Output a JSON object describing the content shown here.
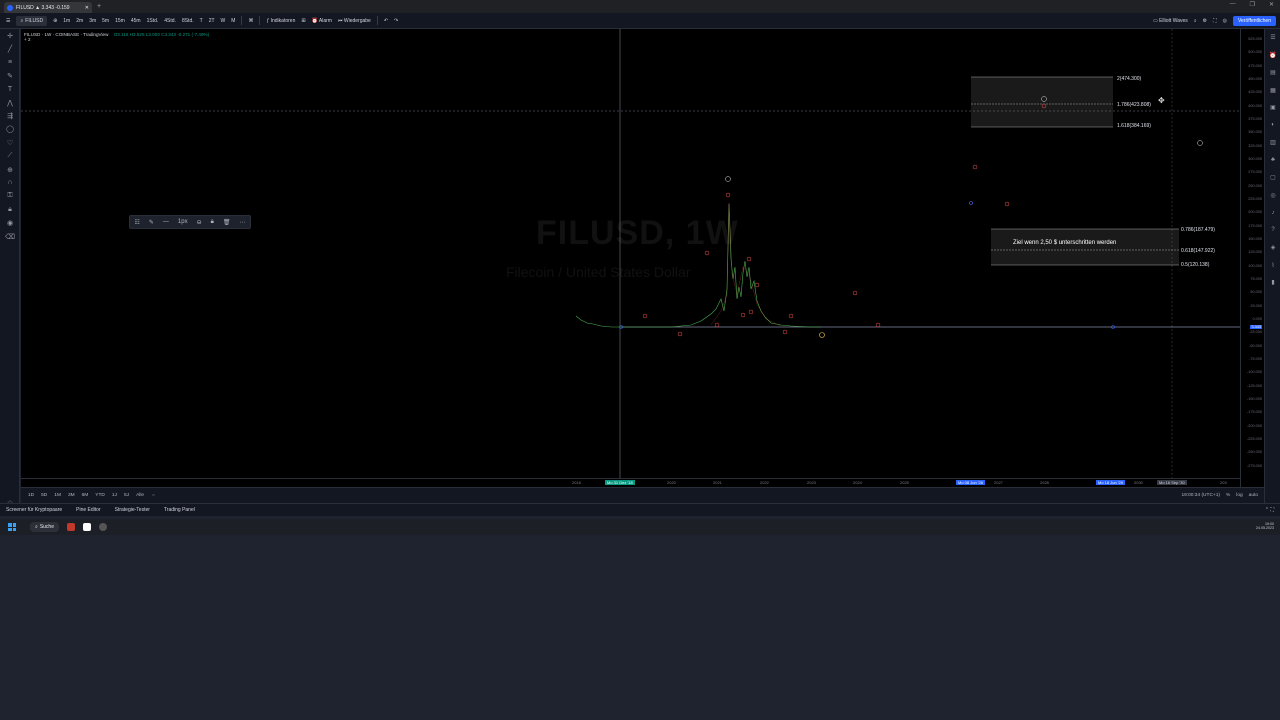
{
  "browser": {
    "tab_title": "FILUSD ▲ 3.343 -0.159",
    "new_tab": "+",
    "win_controls": [
      "—",
      "❐",
      "✕"
    ]
  },
  "toolbar": {
    "symbol": "FILUSD",
    "intervals": [
      "1m",
      "2m",
      "3m",
      "5m",
      "15m",
      "45m",
      "1Std.",
      "4Std.",
      "8Std.",
      "T",
      "2T",
      "W",
      "M"
    ],
    "indicators_label": "Indikatoren",
    "alert_label": "Alarm",
    "replay_label": "Wiedergabe",
    "layout_label": "Elliott Waves",
    "publish_label": "Veröffentlichen"
  },
  "chart": {
    "title": "FILUSD · 1W · COINBASE · TradingView",
    "ohlc": "O3.116 H3.525 L3.003 C3.343 -0.271 (-7.49%)",
    "sub": "+ 2",
    "watermark_symbol": "FILUSD, 1W",
    "watermark_desc": "Filecoin / United States Dollar",
    "target_text": "Ziel wenn 2,50 $ unterschritten werden",
    "fib_levels": [
      {
        "label": "2(474.300)"
      },
      {
        "label": "1.786(423.808)"
      },
      {
        "label": "1.618(384.169)"
      },
      {
        "label": "0.786(187.479)"
      },
      {
        "label": "0.618(147.922)"
      },
      {
        "label": "0.5(120.138)"
      }
    ],
    "wave_labels_white": [
      "⑤",
      "⑤",
      "②",
      "⑧"
    ],
    "wave_labels_red": [
      "①",
      "②",
      "③",
      "④",
      "⑤",
      "⓪",
      "①",
      "②",
      "③",
      "④",
      "⑤",
      "①",
      "②",
      "③"
    ],
    "price_axis": [
      "525.000",
      "500.000",
      "475.000",
      "450.000",
      "425.000",
      "400.000",
      "375.000",
      "350.000",
      "325.000",
      "300.000",
      "275.000",
      "250.000",
      "225.000",
      "200.000",
      "175.000",
      "150.000",
      "125.000",
      "100.000",
      "75.000",
      "50.000",
      "25.000",
      "0.000",
      "-25.000",
      "-50.000",
      "-75.000",
      "-100.000",
      "-125.000",
      "-150.000",
      "-175.000",
      "-200.000",
      "-225.000",
      "-250.000",
      "-275.000"
    ],
    "price_current": "3.343",
    "time_axis": [
      "2018",
      "2020",
      "2021",
      "2022",
      "2023",
      "2024",
      "2025",
      "2027",
      "2028",
      "2030",
      "203"
    ],
    "time_highlights": [
      "Mo 31 Dez '18",
      "Mo 08 Jun '26",
      "Mo 18 Jun '29",
      "Mo 16 Sep '30"
    ]
  },
  "draw_toolbar": {
    "width_label": "1px"
  },
  "bottom_row": {
    "ranges": [
      "1D",
      "5D",
      "1M",
      "3M",
      "6M",
      "YTD",
      "1J",
      "5J",
      "Alle"
    ],
    "time": "19:00:34 (UTC+1)",
    "pct": "%",
    "log": "log",
    "auto": "auto"
  },
  "bottom_tabs": [
    "Screener für Kryptopaare",
    "Pine Editor",
    "Strategie-Tester",
    "Trading Panel"
  ],
  "taskbar": {
    "search": "Suche",
    "clock_time": "19:00",
    "clock_date": "24.05.2023"
  }
}
